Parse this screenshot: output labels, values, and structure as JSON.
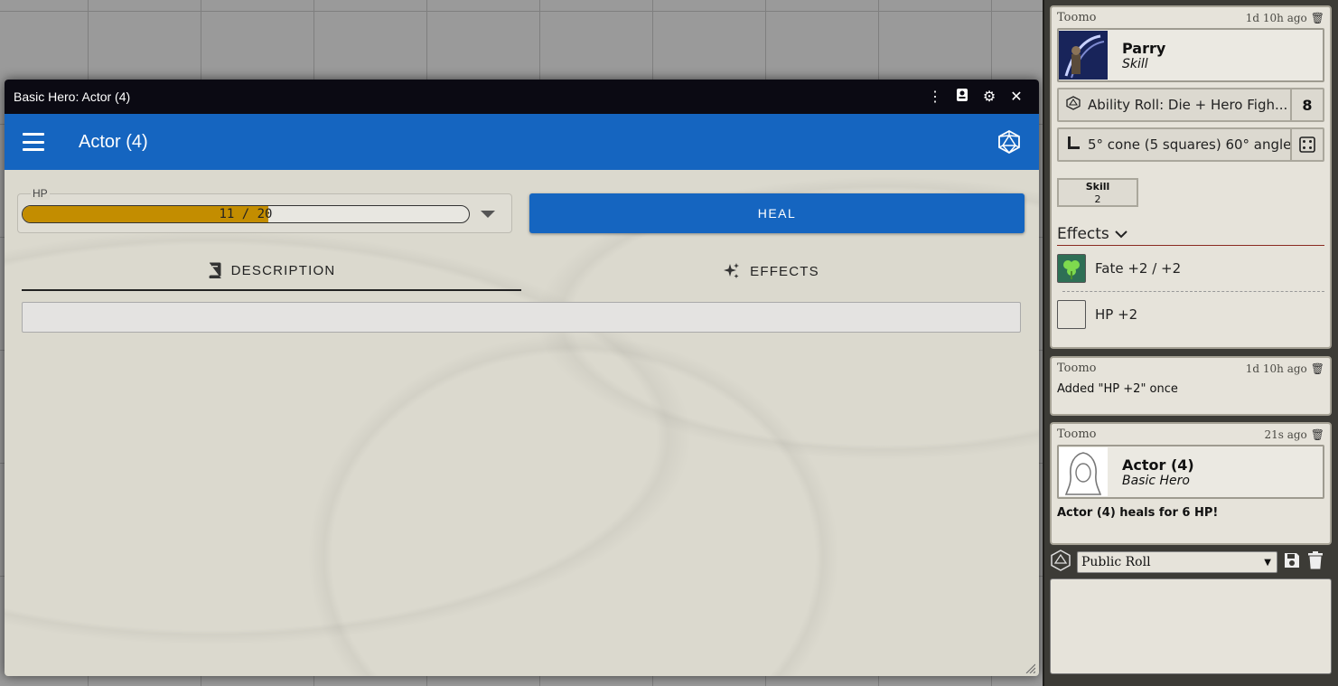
{
  "window": {
    "title": "Basic Hero: Actor (4)",
    "controls": [
      "more-vert-icon",
      "token-icon",
      "gear-icon",
      "close-icon"
    ]
  },
  "sheet": {
    "actor_name": "Actor (4)",
    "hp": {
      "label": "HP",
      "value": 11,
      "max": 20,
      "text": "11 / 20",
      "fill_color": "#c38d00"
    },
    "heal_label": "HEAL",
    "tabs": [
      {
        "label": "DESCRIPTION",
        "icon": "book-icon",
        "active": true
      },
      {
        "label": "EFFECTS",
        "icon": "sparkles-icon",
        "active": false
      }
    ],
    "accent": "#1565c0"
  },
  "chat": {
    "messages": [
      {
        "user": "Toomo",
        "time": "1d 10h ago",
        "card": {
          "title": "Parry",
          "subtitle": "Skill"
        },
        "rolls": [
          {
            "text": "Ability Roll: Die + Hero Figh...",
            "value": "8",
            "icon": "d20-icon"
          },
          {
            "text": "5° cone (5 squares) 60° angle",
            "icon": "ruler-icon",
            "action_icon": "dice-icon"
          }
        ],
        "skill_box": {
          "label": "Skill",
          "value": "2"
        },
        "effects_heading": "Effects",
        "effects": [
          {
            "label": "Fate +2 / +2",
            "icon": "clover-icon"
          },
          {
            "label": "HP +2",
            "icon": "blank-icon"
          }
        ]
      },
      {
        "user": "Toomo",
        "time": "1d 10h ago",
        "text": "Added \"HP +2\" once"
      },
      {
        "user": "Toomo",
        "time": "21s ago",
        "card": {
          "title": "Actor (4)",
          "subtitle": "Basic Hero"
        },
        "text": "Actor (4) heals for 6 HP!"
      }
    ],
    "roll_mode": "Public Roll"
  }
}
